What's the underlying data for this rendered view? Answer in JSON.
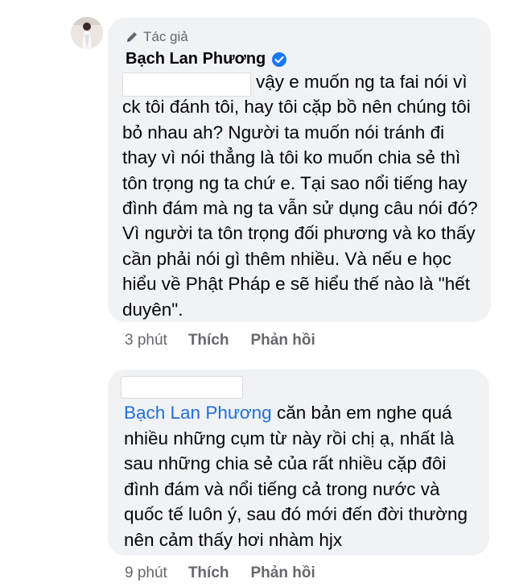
{
  "comment1": {
    "badge_label": "Tác giả",
    "author_name": "Bạch Lan Phương",
    "text": "vậy e muốn ng ta fai nói vì ck tôi đánh tôi, hay tôi cặp bồ nên chúng tôi bỏ nhau ah? Người ta muốn nói tránh đi thay vì nói thẳng là tôi ko muốn chia sẻ thì tôn trọng ng ta chứ e. Tại sao nổi tiếng hay đình đám mà ng ta vẫn sử dụng câu nói đó? Vì người ta tôn trọng đối phương và ko thấy cần phải nói gì thêm nhiều. Và nếu e học hiểu về Phật Pháp e sẽ hiểu thế nào là \"hết duyên\".",
    "time": "3 phút",
    "like_label": "Thích",
    "reply_label": "Phản hồi"
  },
  "comment2": {
    "mention": "Bạch Lan Phương",
    "text": " căn bản em nghe quá nhiều những cụm từ này rồi chị ạ, nhất là sau những chia sẻ của rất nhiều cặp đôi đình đám và nổi tiếng cả trong nước và quốc tế luôn ý, sau đó mới đến đời thường nên cảm thấy hơi nhàm hjx",
    "time": "9 phút",
    "like_label": "Thích",
    "reply_label": "Phản hồi"
  },
  "colors": {
    "bubble": "#f0f2f5",
    "mention": "#216fdb",
    "verified": "#1877f2",
    "meta": "#65676b"
  },
  "icons": {
    "badge": "pen-icon",
    "verified": "verified-badge-icon"
  }
}
